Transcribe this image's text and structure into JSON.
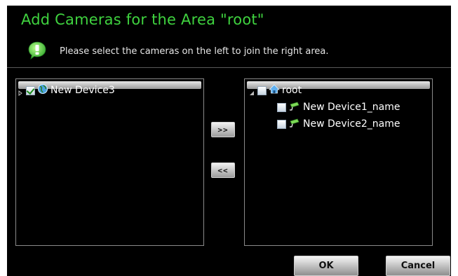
{
  "dialog": {
    "title": "Add Cameras for the Area \"root\"",
    "hint": "Please select the cameras on the left to join the right area."
  },
  "left_tree": {
    "items": [
      {
        "label": "New Device3",
        "checked": true,
        "icon": "device-globe-icon"
      }
    ]
  },
  "right_tree": {
    "root": {
      "label": "root",
      "checked": false,
      "icon": "home-icon"
    },
    "children": [
      {
        "label": "New Device1_name",
        "checked": false,
        "icon": "camera-icon"
      },
      {
        "label": "New Device2_name",
        "checked": false,
        "icon": "camera-icon"
      }
    ]
  },
  "buttons": {
    "add": ">>",
    "remove": "<<",
    "ok": "OK",
    "cancel": "Cancel"
  },
  "colors": {
    "title": "#3fd23f",
    "background": "#000000"
  }
}
